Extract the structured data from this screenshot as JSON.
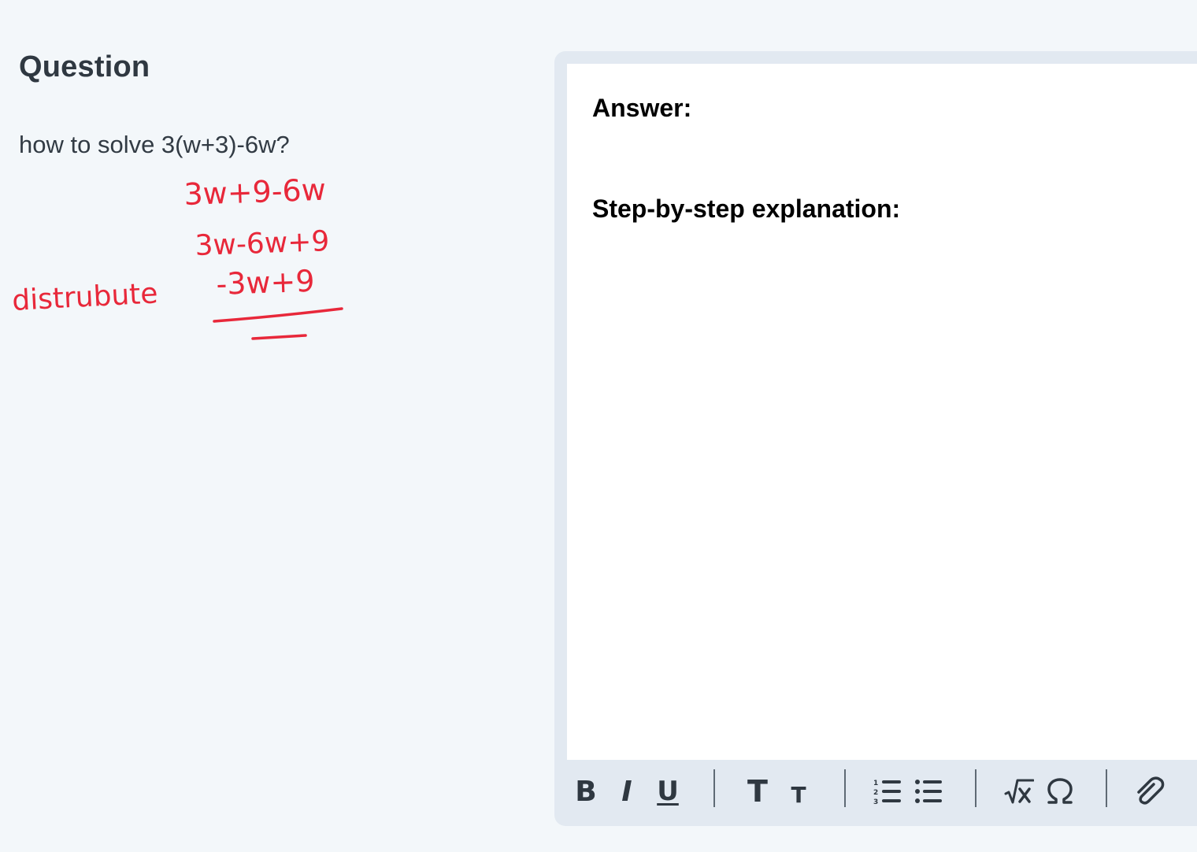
{
  "question": {
    "title": "Question",
    "text": "how to solve 3(w+3)-6w?",
    "handwritten": {
      "line1": "3w+9-6w",
      "line2": "3w-6w+9",
      "line3": "-3w+9",
      "side_note": "distrubute",
      "ink_color": "#e8283a"
    }
  },
  "editor": {
    "answer_label": "Answer:",
    "steps_label": "Step-by-step explanation:"
  },
  "toolbar": {
    "bold_glyph": "B",
    "italic_glyph": "I",
    "underline_glyph": "U",
    "large_text_glyph": "T",
    "small_text_glyph": "T",
    "icons": [
      "bold-icon",
      "italic-icon",
      "underline-icon",
      "heading-large-icon",
      "heading-small-icon",
      "numbered-list-icon",
      "bulleted-list-icon",
      "math-equation-icon",
      "omega-symbol-icon",
      "paperclip-icon"
    ]
  },
  "colors": {
    "background": "#f3f7fa",
    "frame": "#e2e9f1",
    "text": "#323b44"
  }
}
